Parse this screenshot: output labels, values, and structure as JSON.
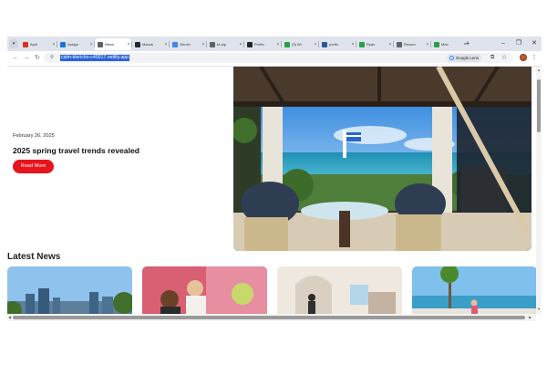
{
  "browser": {
    "tabs": [
      {
        "title": "April",
        "favicon_color": "#d93025"
      },
      {
        "title": "Assign",
        "favicon_color": "#1a73e8"
      },
      {
        "title": "News",
        "favicon_color": "#5f6368",
        "active": true
      },
      {
        "title": "Manus",
        "favicon_color": "#24292e"
      },
      {
        "title": "Gemin",
        "favicon_color": "#4285f4"
      },
      {
        "title": "fa-lap",
        "favicon_color": "#5f6368"
      },
      {
        "title": "Portfo",
        "favicon_color": "#24292e"
      },
      {
        "title": "(3) Wi",
        "favicon_color": "#25a244"
      },
      {
        "title": "portfo",
        "favicon_color": "#2b579a"
      },
      {
        "title": "Ryan",
        "favicon_color": "#25a244"
      },
      {
        "title": "Resum",
        "favicon_color": "#5f6368"
      },
      {
        "title": "Man",
        "favicon_color": "#25a244"
      }
    ],
    "new_tab_label": "+",
    "tab_close_glyph": "×",
    "url": "calm-klericho-c40017.netlify.app",
    "lens_label": "Google Lens",
    "controls": {
      "back": "←",
      "forward": "→",
      "reload": "↻",
      "minimize": "–",
      "restore": "❐",
      "close": "✕",
      "menu": "⋮",
      "tab_search": "▾",
      "bookmark": "☆",
      "translate": "⧉",
      "site_info": "⚲"
    }
  },
  "hero": {
    "date": "February 26, 2025",
    "title": "2025 spring travel trends revealed",
    "button": "Read More",
    "button_color": "#e8141b"
  },
  "latest": {
    "heading": "Latest News",
    "cards": [
      {
        "image": "city-skyline"
      },
      {
        "image": "friends-cafe"
      },
      {
        "image": "arched-interior"
      },
      {
        "image": "seaside-terrace"
      }
    ]
  },
  "colors": {
    "tabstrip": "#dfe4ec",
    "url_selection": "#2b63d9",
    "accent_red": "#e8141b"
  }
}
